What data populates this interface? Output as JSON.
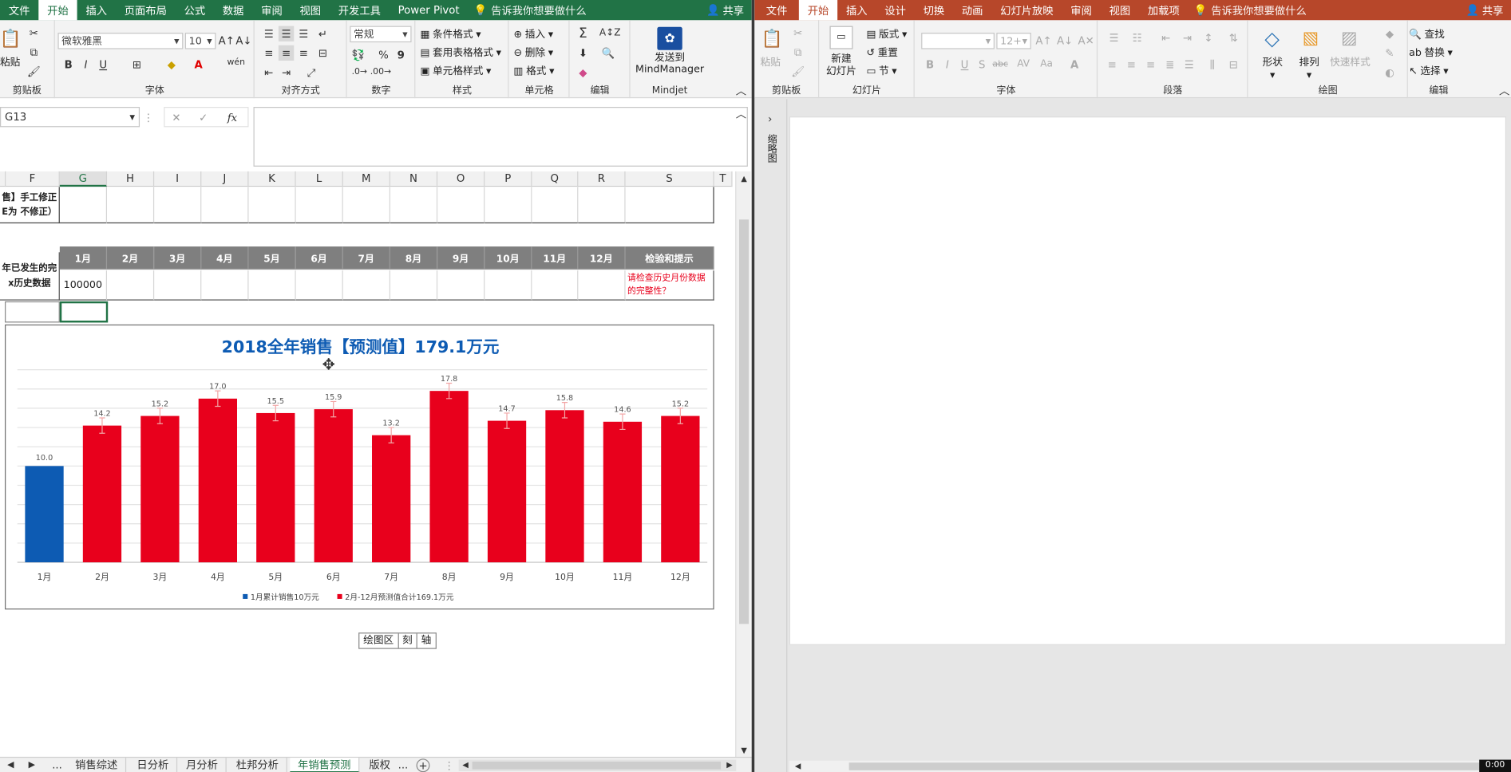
{
  "excel": {
    "tabs": [
      "文件",
      "开始",
      "插入",
      "页面布局",
      "公式",
      "数据",
      "审阅",
      "视图",
      "开发工具",
      "Power Pivot"
    ],
    "active_tab": "开始",
    "tell_me": "告诉我你想要做什么",
    "share": "共享",
    "ribbon": {
      "clipboard": {
        "label": "剪贴板",
        "paste": "粘贴"
      },
      "font": {
        "label": "字体",
        "font_name": "微软雅黑",
        "font_size": "10",
        "bold": "B",
        "italic": "I",
        "underline": "U",
        "wen": "wén"
      },
      "alignment": {
        "label": "对齐方式"
      },
      "number": {
        "label": "数字",
        "format": "常规",
        "percent": "%",
        "comma": "9"
      },
      "styles": {
        "label": "样式",
        "conditional": "条件格式",
        "table": "套用表格格式",
        "cell": "单元格样式"
      },
      "cells": {
        "label": "单元格",
        "insert": "插入",
        "delete": "删除",
        "format": "格式"
      },
      "editing": {
        "label": "编辑"
      },
      "mindjet": {
        "label": "Mindjet",
        "send_line1": "发送到",
        "send_line2": "MindManager"
      }
    },
    "name_box": "G13",
    "formula_value": "",
    "columns": [
      "F",
      "G",
      "H",
      "I",
      "J",
      "K",
      "L",
      "M",
      "N",
      "O",
      "P",
      "Q",
      "R",
      "S",
      "T"
    ],
    "selected_column": "G",
    "row_a_label_line1": "售】手工修正",
    "row_a_label_line2": "E为 不修正）",
    "month_headers": [
      "1月",
      "2月",
      "3月",
      "4月",
      "5月",
      "6月",
      "7月",
      "8月",
      "9月",
      "10月",
      "11月",
      "12月"
    ],
    "check_header": "检验和提示",
    "history_label_line1": "年已发生的完",
    "history_label_line2": "x历史数据",
    "history_value_jan": "100000",
    "warning_line1": "请检查历史月份数据",
    "warning_line2": "的完整性？",
    "sheet_tabs": [
      "销售综述",
      "日分析",
      "月分析",
      "杜邦分析",
      "年销售预测",
      "版权"
    ],
    "active_sheet": "年销售预测",
    "nav_ellipsis": "...",
    "tooltip": [
      "绘图区",
      "刻",
      "轴"
    ]
  },
  "chart_data": {
    "type": "bar",
    "title": "2018全年销售【预测值】179.1万元",
    "categories": [
      "1月",
      "2月",
      "3月",
      "4月",
      "5月",
      "6月",
      "7月",
      "8月",
      "9月",
      "10月",
      "11月",
      "12月"
    ],
    "values": [
      10.0,
      14.2,
      15.2,
      17.0,
      15.5,
      15.9,
      13.2,
      17.8,
      14.7,
      15.8,
      14.6,
      15.2
    ],
    "value_labels": [
      "10.0",
      "14.2",
      "15.2",
      "17.0",
      "15.5",
      "15.9",
      "13.2",
      "17.8",
      "14.7",
      "15.8",
      "14.6",
      "15.2"
    ],
    "ylim": [
      0,
      20
    ],
    "series": [
      {
        "name": "1月累计销售10万元",
        "color": "#0d5bb3"
      },
      {
        "name": "2月-12月预测值合计169.1万元",
        "color": "#e8001c"
      }
    ],
    "error_bars": true,
    "grid": true,
    "legend": "bottom",
    "title_color": "#0d5bb3"
  },
  "ppt": {
    "tabs": [
      "文件",
      "开始",
      "插入",
      "设计",
      "切换",
      "动画",
      "幻灯片放映",
      "审阅",
      "视图",
      "加载项"
    ],
    "active_tab": "开始",
    "tell_me": "告诉我你想要做什么",
    "share": "共享",
    "ribbon": {
      "clipboard": {
        "label": "剪贴板",
        "paste": "粘贴"
      },
      "slides": {
        "label": "幻灯片",
        "new_line1": "新建",
        "new_line2": "幻灯片",
        "layout": "版式",
        "reset": "重置",
        "section": "节"
      },
      "font": {
        "label": "字体",
        "size": "12+",
        "bold": "B",
        "italic": "I",
        "underline": "U",
        "shadow": "S",
        "strike": "abc",
        "spacing": "AV",
        "case": "Aa"
      },
      "paragraph": {
        "label": "段落"
      },
      "drawing": {
        "label": "绘图",
        "shapes": "形状",
        "arrange": "排列",
        "quick_styles": "快速样式"
      },
      "editing": {
        "label": "编辑",
        "find": "查找",
        "replace": "替换",
        "select": "选择"
      }
    },
    "thumbnails_label": "缩略图"
  },
  "timer": "0:00",
  "colors": {
    "excel_green": "#217346",
    "ppt_red": "#b7472a",
    "header_gray": "#7f7f7f",
    "warning_red": "#e8001c"
  }
}
